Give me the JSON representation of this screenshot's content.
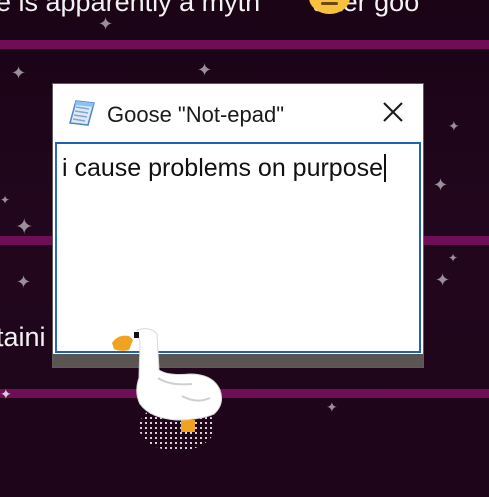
{
  "background": {
    "top_text": "e is apparently a myth",
    "top_text_tail": " after goo",
    "side_text": "taini",
    "emoji": "neutral-face-emoji"
  },
  "notepad": {
    "title": "Goose \"Not-epad\"",
    "icon": "notepad-icon",
    "close_icon": "close-icon",
    "content": "i cause problems on purpose"
  },
  "goose": {
    "icon": "goose-icon"
  },
  "colors": {
    "background": "#1e0519",
    "stripe": "#6e0e56",
    "editor_border": "#1f63b0",
    "statusbar": "#5a5553",
    "emoji": "#f7c13b"
  }
}
